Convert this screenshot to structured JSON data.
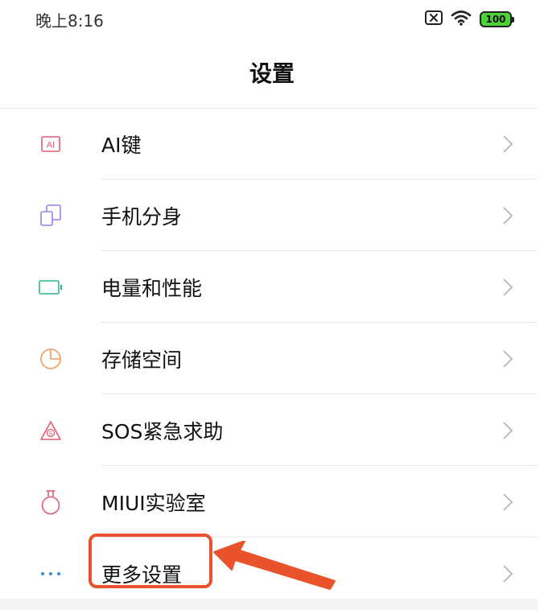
{
  "status_bar": {
    "time": "晚上8:16",
    "battery": "100",
    "icons": [
      "sim-off-icon",
      "wifi-icon",
      "battery-icon"
    ],
    "battery_color": "#4cd137"
  },
  "page": {
    "title": "设置"
  },
  "settings": {
    "items": [
      {
        "label": "AI键",
        "icon": "ai-key-icon",
        "icon_color": "#e05a73"
      },
      {
        "label": "手机分身",
        "icon": "phone-clone-icon",
        "icon_color": "#9b7fe3"
      },
      {
        "label": "电量和性能",
        "icon": "battery-performance-icon",
        "icon_color": "#2fb38c"
      },
      {
        "label": "存储空间",
        "icon": "storage-icon",
        "icon_color": "#f09a5a"
      },
      {
        "label": "SOS紧急求助",
        "icon": "sos-icon",
        "icon_color": "#e05a73"
      },
      {
        "label": "MIUI实验室",
        "icon": "lab-icon",
        "icon_color": "#e05a73"
      },
      {
        "label": "更多设置",
        "icon": "more-icon",
        "icon_color": "#3a8fd6"
      }
    ]
  },
  "annotation": {
    "highlight_color": "#e8532b",
    "target": "更多设置"
  }
}
